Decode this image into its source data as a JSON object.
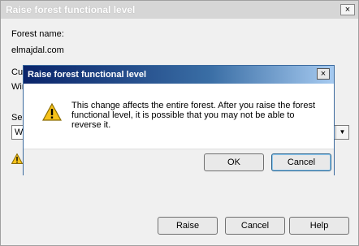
{
  "outer": {
    "title": "Raise forest functional level",
    "close_label": "×",
    "forest_name_label": "Forest name:",
    "forest_name_value": "elmajdal.com",
    "current_label_partial": "Cur",
    "current_value_partial": "Wir",
    "select_label_partial": "Sel",
    "select_value_partial": "W",
    "select_arrow": "▼",
    "raise_label": "Raise",
    "cancel_label": "Cancel",
    "help_label": "Help"
  },
  "dialog": {
    "title": "Raise forest functional level",
    "close_label": "×",
    "message": "This change affects the entire forest. After you raise the forest functional level, it is possible that you may not be able to reverse it.",
    "ok_label": "OK",
    "cancel_label": "Cancel"
  },
  "icons": {
    "outer_warning": "warning-icon",
    "dialog_warning": "warning-icon"
  }
}
